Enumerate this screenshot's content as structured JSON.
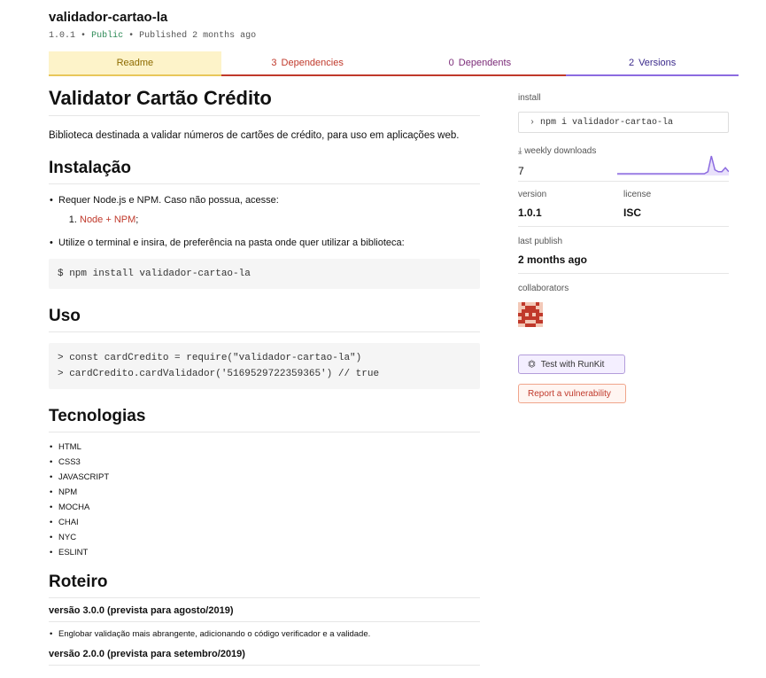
{
  "header": {
    "package_name": "validador-cartao-la",
    "version": "1.0.1",
    "visibility": "Public",
    "published": "Published 2 months ago",
    "separator": "•"
  },
  "tabs": [
    {
      "label": "Readme",
      "count": ""
    },
    {
      "label": "Dependencies",
      "count": "3"
    },
    {
      "label": "Dependents",
      "count": "0"
    },
    {
      "label": "Versions",
      "count": "2"
    }
  ],
  "readme": {
    "title": "Validator Cartão Crédito",
    "description": "Biblioteca destinada a validar números de cartões de crédito, para uso em aplicações web.",
    "installation": {
      "heading": "Instalação",
      "bullet1": "Requer Node.js e NPM. Caso não possua, acesse:",
      "sub1_link": "Node + NPM",
      "sub1_tail": ";",
      "bullet2": "Utilize o terminal e insira, de preferência na pasta onde quer utilizar a biblioteca:",
      "code": "$ npm install validador-cartao-la"
    },
    "usage": {
      "heading": "Uso",
      "code_line1": "> const cardCredito = require(\"validador-cartao-la\")",
      "code_line2": "> cardCredito.cardValidador('5169529722359365') // true"
    },
    "tech": {
      "heading": "Tecnologias",
      "items": [
        "HTML",
        "CSS3",
        "JAVASCRIPT",
        "NPM",
        "MOCHA",
        "CHAI",
        "NYC",
        "ESLINT"
      ]
    },
    "roadmap": {
      "heading": "Roteiro",
      "v3": "versão 3.0.0 (prevista para agosto/2019)",
      "v3_note": "Englobar validação mais abrangente, adicionando o código verificador e a validade.",
      "v2": "versão 2.0.0 (prevista para setembro/2019)"
    }
  },
  "sidebar": {
    "install_label": "install",
    "install_cmd": "npm i validador-cartao-la",
    "downloads_label": "weekly downloads",
    "downloads_count": "7",
    "downloads_trend": [
      0,
      0,
      0,
      0,
      0,
      0,
      0,
      0,
      0,
      0,
      0,
      0,
      0,
      0,
      0,
      0,
      0,
      0,
      0,
      0,
      0,
      0,
      0,
      0,
      0,
      0,
      1,
      9,
      2,
      1,
      1,
      3,
      1
    ],
    "version_label": "version",
    "version_value": "1.0.1",
    "license_label": "license",
    "license_value": "ISC",
    "last_publish_label": "last publish",
    "last_publish_value": "2 months ago",
    "collaborators_label": "collaborators",
    "runkit_label": "Test with RunKit",
    "vuln_label": "Report a vulnerability"
  },
  "colors": {
    "accent_purple": "#8c6be0",
    "accent_red": "#c0392b",
    "readme_tab_bg": "#fdf3c9"
  }
}
